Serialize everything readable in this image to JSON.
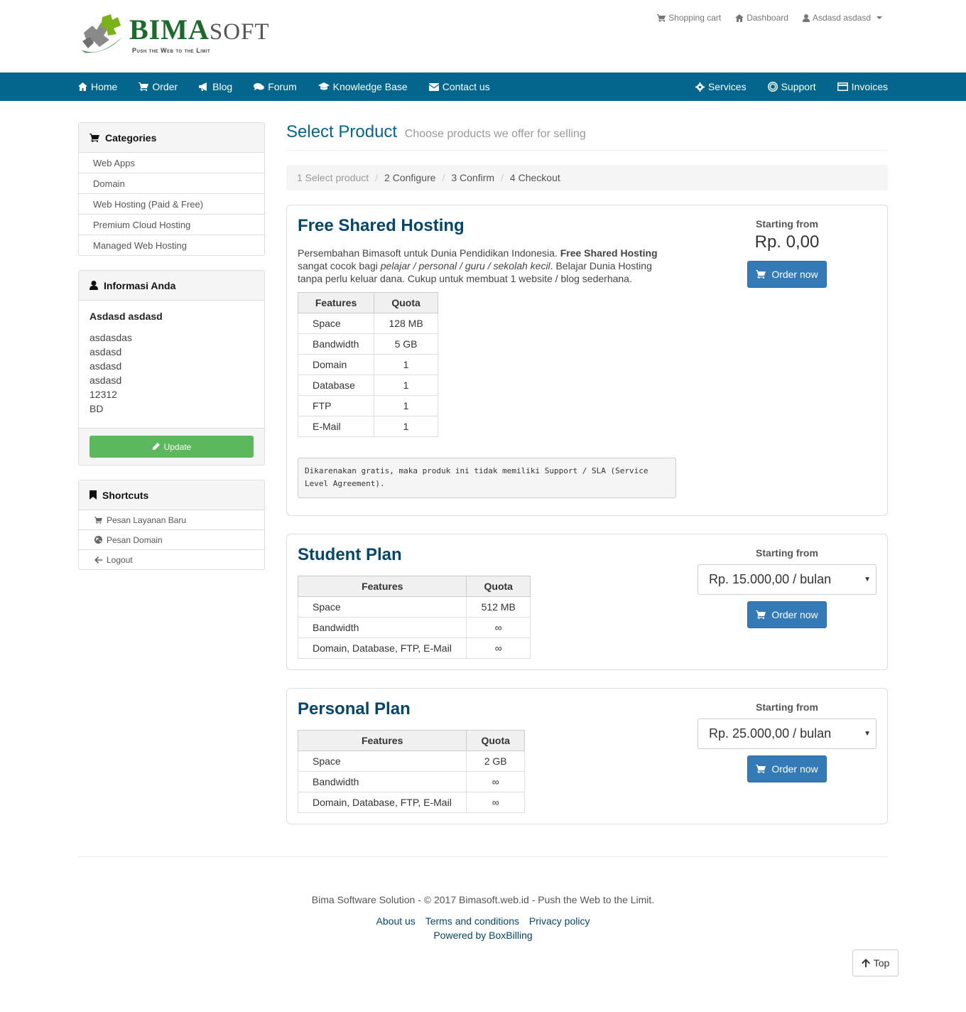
{
  "brand": {
    "name_main": "BIMA",
    "name_soft": "SOFT",
    "tagline": "Push the Web to the Limit"
  },
  "toplinks": {
    "cart": "Shopping cart",
    "dashboard": "Dashboard",
    "user": "Asdasd asdasd"
  },
  "nav": {
    "home": "Home",
    "order": "Order",
    "blog": "Blog",
    "forum": "Forum",
    "kb": "Knowledge Base",
    "contact": "Contact us",
    "services": "Services",
    "support": "Support",
    "invoices": "Invoices"
  },
  "categories": {
    "title": "Categories",
    "items": [
      "Web Apps",
      "Domain",
      "Web Hosting (Paid & Free)",
      "Premium Cloud Hosting",
      "Managed Web Hosting"
    ]
  },
  "info": {
    "title": "Informasi Anda",
    "name": "Asdasd asdasd",
    "lines": [
      "asdasdas",
      "asdasd",
      "asdasd",
      "asdasd",
      "12312",
      "BD"
    ],
    "update": "Update"
  },
  "shortcuts": {
    "title": "Shortcuts",
    "items": [
      "Pesan Layanan Baru",
      "Pesan Domain",
      "Logout"
    ]
  },
  "page": {
    "title": "Select Product",
    "subtitle": "Choose products we offer for selling"
  },
  "steps": [
    "1 Select product",
    "2 Configure",
    "3 Confirm",
    "4 Checkout"
  ],
  "products": [
    {
      "title": "Free Shared Hosting",
      "desc_1": "Persembahan Bimasoft untuk Dunia Pendidikan Indonesia. ",
      "desc_bold": "Free Shared Hosting",
      "desc_2": " sangat cocok bagi ",
      "desc_italic": "pelajar / personal / guru / sekolah kecil",
      "desc_3": ". Belajar Dunia Hosting tanpa perlu keluar dana. Cukup untuk membuat 1 website / blog sederhana.",
      "headers": [
        "Features",
        "Quota"
      ],
      "rows": [
        [
          "Space",
          "128 MB"
        ],
        [
          "Bandwidth",
          "5 GB"
        ],
        [
          "Domain",
          "1"
        ],
        [
          "Database",
          "1"
        ],
        [
          "FTP",
          "1"
        ],
        [
          "E-Mail",
          "1"
        ]
      ],
      "note": "Dikarenakan gratis, maka produk ini tidak memiliki Support / SLA (Service Level Agreement).",
      "starting_label": "Starting from",
      "price": "Rp. 0,00",
      "order": "Order now"
    },
    {
      "title": "Student Plan",
      "headers": [
        "Features",
        "Quota"
      ],
      "rows": [
        [
          "Space",
          "512 MB"
        ],
        [
          "Bandwidth",
          "∞"
        ],
        [
          "Domain, Database, FTP, E-Mail",
          "∞"
        ]
      ],
      "starting_label": "Starting from",
      "price": "Rp. 15.000,00 / bulan",
      "order": "Order now"
    },
    {
      "title": "Personal Plan",
      "headers": [
        "Features",
        "Quota"
      ],
      "rows": [
        [
          "Space",
          "2 GB"
        ],
        [
          "Bandwidth",
          "∞"
        ],
        [
          "Domain, Database, FTP, E-Mail",
          "∞"
        ]
      ],
      "starting_label": "Starting from",
      "price": "Rp. 25.000,00 / bulan",
      "order": "Order now"
    }
  ],
  "footer": {
    "copyright": "Bima Software Solution - © 2017 Bimasoft.web.id - Push the Web to the Limit.",
    "links": [
      "About us",
      "Terms and conditions",
      "Privacy policy"
    ],
    "powered": "Powered by BoxBilling",
    "top": "Top"
  }
}
